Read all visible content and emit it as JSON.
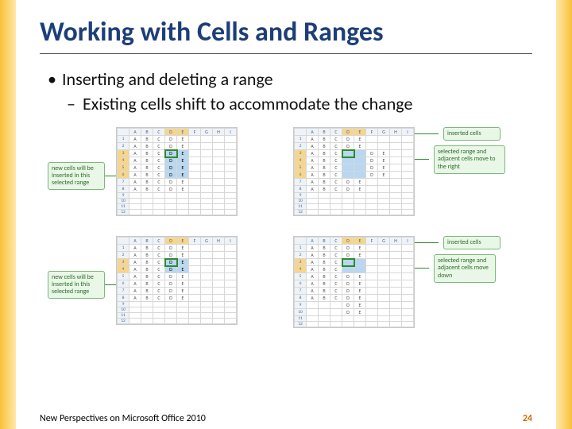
{
  "title": "Working with Cells and Ranges",
  "bullets": {
    "b1": "Inserting and deleting a range",
    "b2": "Existing cells shift to accommodate the change"
  },
  "callouts": {
    "tl": "new cells will be inserted in this selected range",
    "bl": "new cells will be inserted in this selected range",
    "tr1": "inserted cells",
    "tr2": "selected range and adjacent cells move to the right",
    "br1": "inserted cells",
    "br2": "selected range and adjacent cells move down"
  },
  "footer": {
    "text": "New Perspectives on Microsoft Office 2010",
    "page": "24"
  },
  "cols": [
    "",
    "A",
    "B",
    "C",
    "D",
    "E",
    "F",
    "G",
    "H",
    "I"
  ]
}
